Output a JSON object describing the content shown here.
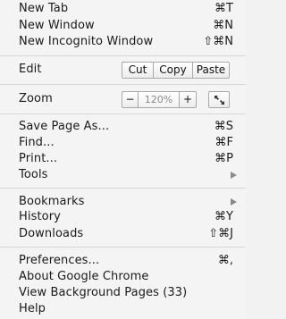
{
  "menu": {
    "new_tab": {
      "label": "New Tab",
      "shortcut": "⌘T"
    },
    "new_window": {
      "label": "New Window",
      "shortcut": "⌘N"
    },
    "new_incognito": {
      "label": "New Incognito Window",
      "shortcut": "⇧⌘N"
    },
    "edit": {
      "label": "Edit",
      "cut": "Cut",
      "copy": "Copy",
      "paste": "Paste"
    },
    "zoom": {
      "label": "Zoom",
      "minus": "−",
      "value": "120%",
      "plus": "+"
    },
    "save_page": {
      "label": "Save Page As...",
      "shortcut": "⌘S"
    },
    "find": {
      "label": "Find...",
      "shortcut": "⌘F"
    },
    "print": {
      "label": "Print...",
      "shortcut": "⌘P"
    },
    "tools": {
      "label": "Tools"
    },
    "bookmarks": {
      "label": "Bookmarks"
    },
    "history": {
      "label": "History",
      "shortcut": "⌘Y"
    },
    "downloads": {
      "label": "Downloads",
      "shortcut": "⇧⌘J"
    },
    "preferences": {
      "label": "Preferences...",
      "shortcut": "⌘,"
    },
    "about": {
      "label": "About Google Chrome"
    },
    "background_pages": {
      "label": "View Background Pages (33)"
    },
    "help": {
      "label": "Help"
    }
  },
  "icons": {
    "submenu": "submenu-arrow-icon",
    "fullscreen": "fullscreen-icon"
  },
  "colors": {
    "background": "#f4f4f4",
    "separator": "#d7d7d7",
    "arrow": "#8a8a8a"
  }
}
